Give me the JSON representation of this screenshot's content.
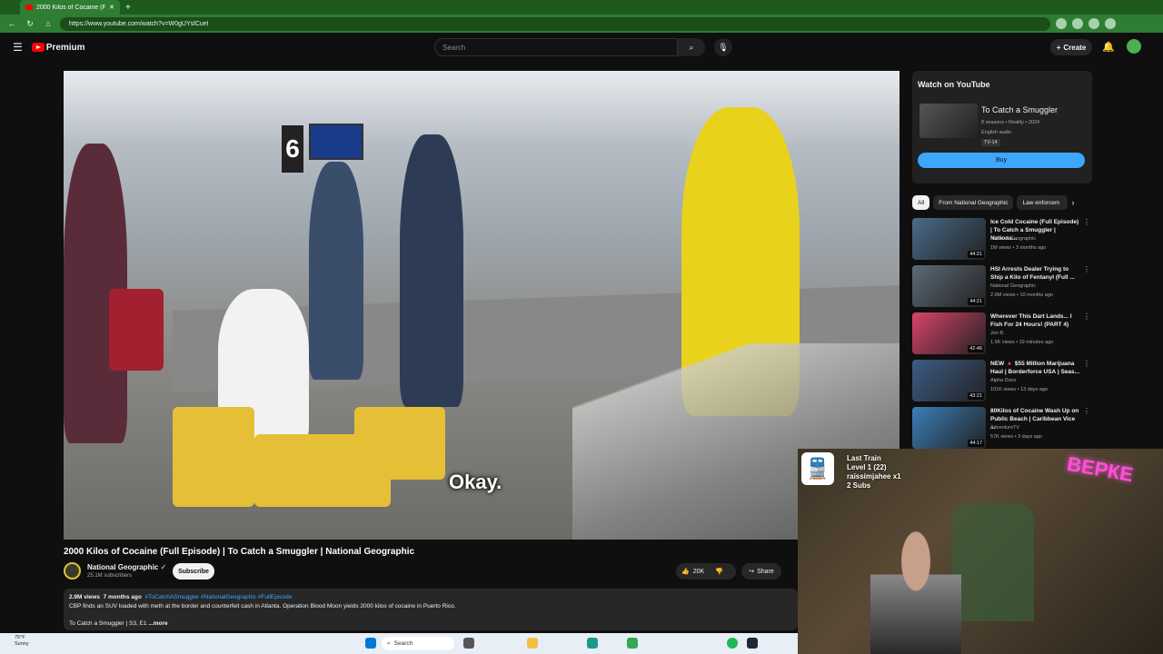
{
  "browser": {
    "tab_title": "2000 Kilos of Cocaine (Full E…",
    "url": "https://www.youtube.com/watch?v=W0gUYslCueI"
  },
  "header": {
    "brand": "Premium",
    "search_placeholder": "Search",
    "create_label": "Create"
  },
  "video": {
    "caption": "Okay.",
    "title": "2000 Kilos of Cocaine (Full Episode) | To Catch a Smuggler | National Geographic",
    "channel": "National Geographic",
    "subscribers": "25.1M subscribers",
    "subscribe_label": "Subscribe",
    "likes": "20K",
    "share_label": "Share",
    "views": "2.9M views",
    "age": "7 months ago",
    "tags": "#ToCatchASmuggler #NationalGeographic #FullEpisode",
    "description": "CBP finds an SUV loaded with meth at the border and counterfeit cash in Atlanta. Operation Blood Moon yields 2000 kilos of cocaine in Puerto Rico.",
    "desc_tail": "To Catch a Smuggler | S3, E1",
    "more_label": "...more"
  },
  "watch_card": {
    "heading": "Watch on YouTube",
    "show": "To Catch a Smuggler",
    "meta1": "8 seasons • Reality • 2024",
    "meta2": "English audio",
    "rating": "TV-14",
    "buy_label": "Buy"
  },
  "chips": [
    "All",
    "From National Geographic",
    "Law enforcem"
  ],
  "recs": [
    {
      "title": "Ice Cold Cocaine (Full Episode) | To Catch a Smuggler | Nationa...",
      "channel": "National Geographic",
      "meta": "1M views • 3 months ago",
      "duration": "44:21",
      "color": "#4a6b8a"
    },
    {
      "title": "HSI Arrests Dealer Trying to Ship a Kilo of Fentanyl (Full ...",
      "channel": "National Geographic",
      "meta": "2.6M views • 10 months ago",
      "duration": "44:21",
      "color": "#5c6a78"
    },
    {
      "title": "Wherever This Dart Lands... I Fish For 24 Hours! (PART 4)",
      "channel": "Jon B.",
      "meta": "1.5K views • 19 minutes ago",
      "duration": "42:46",
      "color": "#d9436a"
    },
    {
      "title": "NEW 🔺 $55 Million Marijuana Haul | Borderforce USA | Seas...",
      "channel": "Alpha Docs",
      "meta": "101K views • 13 days ago",
      "duration": "43:21",
      "color": "#3d5c86"
    },
    {
      "title": "80Kilos of Cocaine Wash Up on Public Beach | Caribbean Vice ...",
      "channel": "AdventureTV",
      "meta": "57K views • 3 days ago",
      "duration": "44:17",
      "color": "#3b7fb8"
    }
  ],
  "overlay": {
    "line1": "Last Train",
    "line2": "Level 1  (22)",
    "line3": "raissimjahee x1",
    "line4": "2 Subs",
    "neon": "ВЕРКЕ"
  },
  "taskbar": {
    "temp": "75°F",
    "cond": "Sunny",
    "search": "Search"
  }
}
